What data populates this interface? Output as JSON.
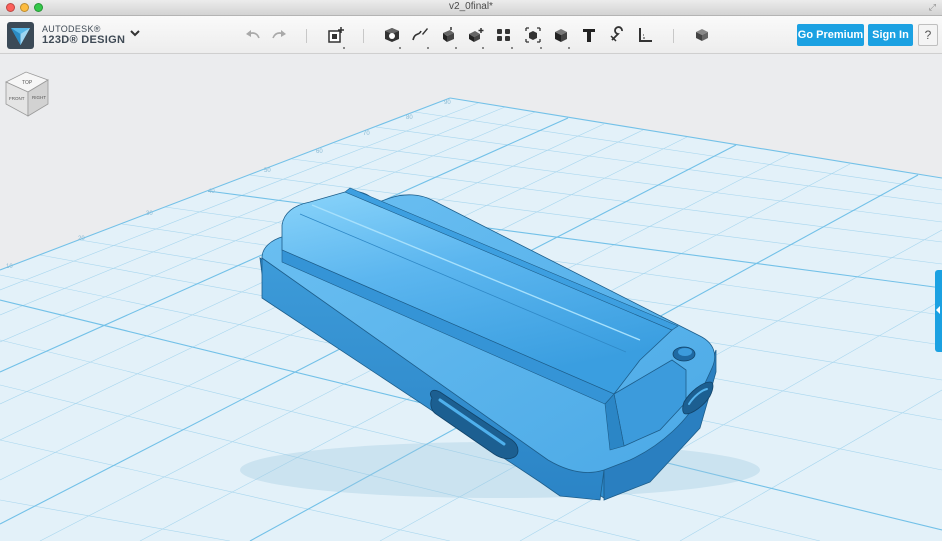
{
  "window": {
    "title": "v2_0final*"
  },
  "brand": {
    "line1": "AUTODESK®",
    "line2": "123D® DESIGN",
    "menu_icon": "chevron-down-icon"
  },
  "toolbar": {
    "history": [
      {
        "name": "undo-icon"
      },
      {
        "name": "redo-icon"
      }
    ],
    "tools": [
      {
        "name": "primitives-icon"
      },
      {
        "name": "sketch-icon"
      },
      {
        "name": "construct-icon"
      },
      {
        "name": "modify-icon"
      },
      {
        "name": "pattern-icon"
      },
      {
        "name": "grouping-icon"
      },
      {
        "name": "combine-icon"
      },
      {
        "name": "text-icon"
      },
      {
        "name": "snap-icon"
      },
      {
        "name": "measure-icon"
      },
      {
        "name": "material-icon"
      }
    ],
    "insert": {
      "name": "insert-icon"
    }
  },
  "account": {
    "premium_label": "Go Premium",
    "signin_label": "Sign In",
    "help_label": "?"
  },
  "viewcube": {
    "top": "TOP",
    "front": "FRONT",
    "right": "RIGHT"
  },
  "grid": {
    "ruler_labels": [
      "10",
      "20",
      "30",
      "40",
      "50",
      "60",
      "70",
      "80",
      "90"
    ]
  },
  "colors": {
    "accent": "#1ba1e2",
    "model": "#4aa8e6",
    "grid": "#7fc8ea",
    "background": "#e9eaec"
  }
}
